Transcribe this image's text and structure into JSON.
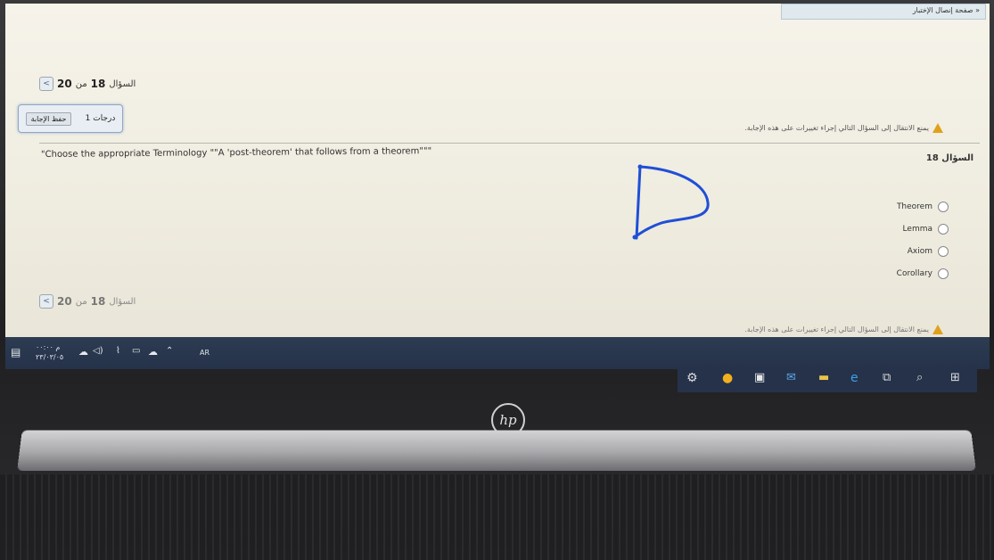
{
  "banner": {
    "text": "« صفحة إنصال الإختبار"
  },
  "navigation": {
    "question_word": "السؤال",
    "current": "18",
    "of_word": "من",
    "total": "20",
    "prev_arrow": "<"
  },
  "question_meta": {
    "points_label": "1 درجات",
    "save_button": "حفظ الإجابة"
  },
  "warning": {
    "text": "يمنع الانتقال إلى السؤال التالي إجراء تغييرات على هذه الإجابة."
  },
  "question": {
    "label": "السؤال 18",
    "text": "\"Choose the appropriate Terminology \"\"A 'post-theorem' that follows from a theorem\"\"\"",
    "options": [
      "Theorem",
      "Lemma",
      "Axiom",
      "Corollary"
    ]
  },
  "taskbar": {
    "clock_time": "م ٠٠:٠٠",
    "clock_date": "٢٣/٠٣/٠٥",
    "language": "AR",
    "accent": "#2d3c52"
  },
  "device": {
    "logo": "hp"
  },
  "colors": {
    "pen_annotation": "#1f4fd6",
    "warning": "#e0a11a"
  }
}
